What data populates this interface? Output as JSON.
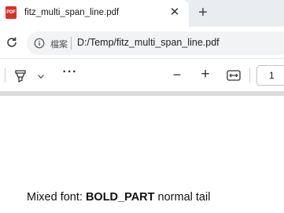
{
  "tab": {
    "icon_text": "PDF",
    "title": "fitz_multi_span_line.pdf",
    "close_glyph": "✕",
    "new_tab_glyph": "+"
  },
  "address": {
    "security_label": "檔案",
    "url": "D:/Temp/fitz_multi_span_line.pdf"
  },
  "toolbar": {
    "more_glyph": "···",
    "zoom_out_glyph": "−",
    "zoom_in_glyph": "+",
    "page_number": "1"
  },
  "document": {
    "line_prefix": "Mixed font: ",
    "line_bold": "BOLD_PART",
    "line_suffix": " normal tail"
  },
  "colors": {
    "tabstrip_bg": "#e9edf1",
    "pdf_icon": "#d93025",
    "address_bg": "#f1f3f4"
  },
  "icons": [
    "pdf-file-icon",
    "close-icon",
    "plus-icon",
    "reload-icon",
    "info-icon",
    "highlighter-icon",
    "chevron-down-icon",
    "more-icon",
    "minus-icon",
    "plus-icon",
    "fit-width-icon"
  ]
}
